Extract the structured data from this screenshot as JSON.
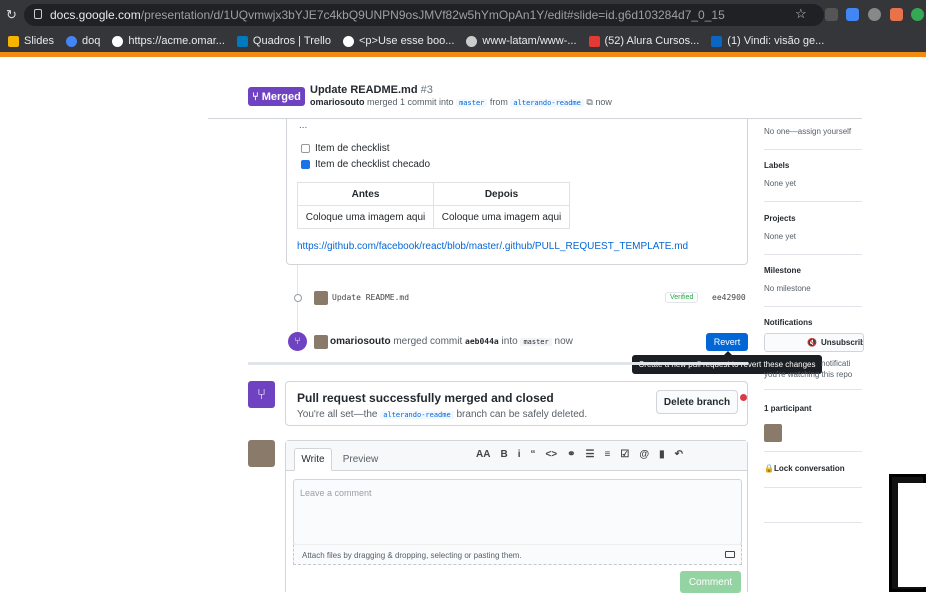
{
  "browser": {
    "url_host": "docs.google.com",
    "url_path": "/presentation/d/1UQvmwjx3bYJE7c4kbQ9UNPN9osJMVf82w5hYmOpAn1Y/edit#slide=id.g6d103284d7_0_15",
    "bookmarks": [
      {
        "label": "Slides",
        "color": "#f4b400"
      },
      {
        "label": "doq",
        "color": "#4285f4"
      },
      {
        "label": "https://acme.omar...",
        "color": "#ffffff"
      },
      {
        "label": "Quadros | Trello",
        "color": "#0079bf"
      },
      {
        "label": "<p>Use esse boo...",
        "color": "#ffffff"
      },
      {
        "label": "www-latam/www-...",
        "color": "#cccccc"
      },
      {
        "label": "(52) Alura Cursos...",
        "color": "#e53935"
      },
      {
        "label": "(1) Vindi: visão ge...",
        "color": "#0a66c2"
      }
    ]
  },
  "pr": {
    "badge": "Merged",
    "title": "Update README.md",
    "number": "#3",
    "author": "omariosouto",
    "summary_1": "merged 1 commit into",
    "base": "master",
    "summary_2": "from",
    "head": "alterando-readme",
    "time": "now"
  },
  "body": {
    "ellipsis": "...",
    "checklist": [
      {
        "label": "Item de checklist",
        "checked": false
      },
      {
        "label": "Item de checklist checado",
        "checked": true
      }
    ],
    "table": {
      "headers": [
        "Antes",
        "Depois"
      ],
      "row": [
        "Coloque uma imagem aqui",
        "Coloque uma imagem aqui"
      ]
    },
    "link": "https://github.com/facebook/react/blob/master/.github/PULL_REQUEST_TEMPLATE.md"
  },
  "commit": {
    "message": "Update README.md",
    "verified": "Verified",
    "sha": "ee42900"
  },
  "merge_event": {
    "author": "omariosouto",
    "text_1": "merged commit",
    "sha": "aeb044a",
    "text_2": "into",
    "branch": "master",
    "time": "now",
    "revert_label": "Revert",
    "tooltip": "Create a new pull request to revert these changes"
  },
  "merged_box": {
    "title": "Pull request successfully merged and closed",
    "text_1": "You're all set—the",
    "branch": "alterando-readme",
    "text_2": "branch can be safely deleted.",
    "delete_label": "Delete branch"
  },
  "comment_form": {
    "tab_write": "Write",
    "tab_preview": "Preview",
    "tools": [
      "AA",
      "B",
      "i",
      "“",
      "<>",
      "⚭",
      "☰",
      "≡",
      "☑",
      "@",
      "▮",
      "↶"
    ],
    "placeholder": "Leave a comment",
    "attach": "Attach files by dragging & dropping, selecting or pasting them.",
    "submit": "Comment"
  },
  "sidebar": {
    "assignees_value": "No one—assign yourself",
    "labels_title": "Labels",
    "labels_value": "None yet",
    "projects_title": "Projects",
    "projects_value": "None yet",
    "milestone_title": "Milestone",
    "milestone_value": "No milestone",
    "notifications_title": "Notifications",
    "unsubscribe": "Unsubscribe",
    "notif_text_1": "notificati",
    "notif_text_2": "you're watching this repo",
    "participants_title": "1 participant",
    "lock": "Lock conversation"
  }
}
